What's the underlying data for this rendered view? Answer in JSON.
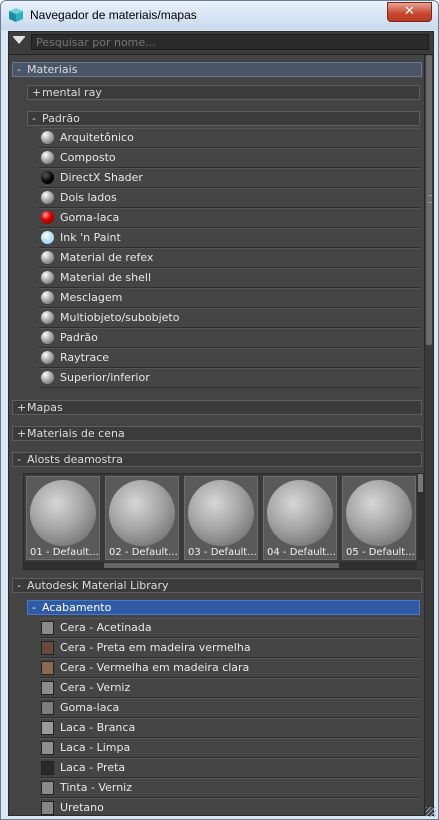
{
  "window": {
    "title": "Navegador de materiais/mapas",
    "close_icon_glyph": "✕"
  },
  "search": {
    "placeholder": "Pesquisar por nome..."
  },
  "groups": {
    "materiais": {
      "sign": "-",
      "label": "Materiais"
    },
    "mental_ray": {
      "sign": "+",
      "label": "mental ray"
    },
    "padrao": {
      "sign": "-",
      "label": "Padrão"
    },
    "mapas": {
      "sign": "+",
      "label": "Mapas"
    },
    "materiais_cena": {
      "sign": "+",
      "label": "Materiais de cena"
    },
    "amostras": {
      "sign": "-",
      "label": "Alosts deamostra"
    },
    "autodesk": {
      "sign": "-",
      "label": "Autodesk Material Library"
    },
    "acabamento": {
      "sign": "-",
      "label": "Acabamento"
    }
  },
  "standard_materials": [
    {
      "label": "Arquitetônico",
      "icon": "gray-sphere-icon"
    },
    {
      "label": "Composto",
      "icon": "gray-sphere-icon"
    },
    {
      "label": "DirectX Shader",
      "icon": "black-sphere-icon"
    },
    {
      "label": "Dois lados",
      "icon": "gray-sphere-icon"
    },
    {
      "label": "Goma-laca",
      "icon": "red-sphere-icon"
    },
    {
      "label": "Ink 'n Paint",
      "icon": "light-blue-sphere-icon"
    },
    {
      "label": "Material de refex",
      "icon": "gray-sphere-icon"
    },
    {
      "label": "Material de shell",
      "icon": "gray-sphere-icon"
    },
    {
      "label": "Mesclagem",
      "icon": "gray-sphere-icon"
    },
    {
      "label": "Multiobjeto/subobjeto",
      "icon": "gray-sphere-icon"
    },
    {
      "label": "Padrão",
      "icon": "gray-sphere-icon"
    },
    {
      "label": "Raytrace",
      "icon": "gray-sphere-icon"
    },
    {
      "label": "Superior/inferior",
      "icon": "gray-sphere-icon"
    }
  ],
  "sample_slots": [
    {
      "label": "01 - Default..."
    },
    {
      "label": "02 - Default..."
    },
    {
      "label": "03 - Default..."
    },
    {
      "label": "04 - Default..."
    },
    {
      "label": "05 - Default..."
    }
  ],
  "acabamento_items": [
    {
      "label": "Cera - Acetinada",
      "color": "#8a8a8a"
    },
    {
      "label": "Cera - Preta em madeira vermelha",
      "color": "#6b4a3e"
    },
    {
      "label": "Cera - Vermelha em madeira clara",
      "color": "#8a6a55"
    },
    {
      "label": "Cera - Verniz",
      "color": "#8d8d8d"
    },
    {
      "label": "Goma-laca",
      "color": "#7e7e7e"
    },
    {
      "label": "Laca - Branca",
      "color": "#9a9a9a"
    },
    {
      "label": "Laca - Limpa",
      "color": "#8f8f8f"
    },
    {
      "label": "Laca - Preta",
      "color": "#2a2a2a"
    },
    {
      "label": "Tinta - Verniz",
      "color": "#8a8a8a"
    },
    {
      "label": "Uretano",
      "color": "#868686"
    }
  ]
}
